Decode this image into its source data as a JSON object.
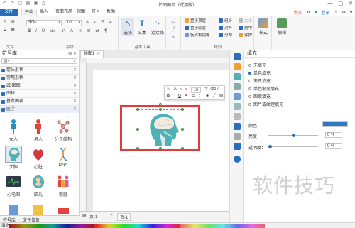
{
  "window": {
    "title": "亿图图示（试用版）",
    "controls": [
      "—",
      "▢",
      "✕"
    ]
  },
  "menu": {
    "items": [
      "文件",
      "开始",
      "插入",
      "页面布局",
      "视图",
      "符号",
      "帮助"
    ],
    "right": {
      "buy": "购买",
      "login": "登录"
    }
  },
  "ribbon": {
    "groups": {
      "file_label": "文件",
      "font_label": "字体",
      "basic_tools_label": "基本工具",
      "arrange_label": "排列"
    },
    "font": {
      "family": "宋体",
      "size": "10",
      "bold": "B",
      "italic": "I",
      "underline": "U",
      "strike": "abc",
      "grow": "A",
      "shrink": "A",
      "color": "A"
    },
    "tools": {
      "select": "选择",
      "text": "文本",
      "connector": "连接线"
    },
    "arrange": {
      "bring_front": "置于顶层",
      "send_back": "置于底层",
      "rotate": "旋转和镜像",
      "group": "组合",
      "align": "对齐",
      "distribute": "分布",
      "size": "大小",
      "center": "居中",
      "protect": "保护"
    },
    "style": {
      "label": "样式"
    },
    "edit": {
      "label": "编辑"
    }
  },
  "library": {
    "title": "符号库",
    "search_placeholder": "",
    "categories": [
      {
        "label": "箭头形状"
      },
      {
        "label": "常用形状"
      },
      {
        "label": "2D图图"
      },
      {
        "label": "图标"
      },
      {
        "label": "基本图表"
      },
      {
        "label": "医学"
      }
    ],
    "shapes": [
      {
        "label": "女人"
      },
      {
        "label": "男人"
      },
      {
        "label": "分子结构"
      },
      {
        "label": "大脑"
      },
      {
        "label": "心脏"
      },
      {
        "label": "DNA"
      },
      {
        "label": "心电图"
      },
      {
        "label": "脑儿"
      },
      {
        "label": "家庭"
      }
    ],
    "bottom_tabs": [
      "符号库",
      "文件恢复"
    ]
  },
  "canvas": {
    "doc_tab": "绘图1",
    "page_tab": "页-1",
    "page_tab2": "页-1",
    "float_toolbar": {
      "font_size": "10",
      "shrink": "A",
      "grow": "A",
      "align": "≡",
      "format": "B",
      "italic": "I",
      "underline": "U",
      "color": "A"
    }
  },
  "fill_panel": {
    "title": "填充",
    "options": [
      {
        "label": "无填充",
        "selected": false
      },
      {
        "label": "单色填充",
        "selected": true
      },
      {
        "label": "渐变填充",
        "selected": false
      },
      {
        "label": "单色渐变填充",
        "selected": false
      },
      {
        "label": "图案填充",
        "selected": false
      },
      {
        "label": "图片或纹理填充",
        "selected": false
      }
    ],
    "color_label": "颜色：",
    "brightness_label": "亮度：",
    "brightness_value": "0 %",
    "transparency_label": "透明度：",
    "transparency_value": "0 %",
    "color_value": "#2e78c2"
  },
  "status": {
    "label": "填充"
  },
  "watermark": "软件技巧",
  "colors": {
    "accent": "#2a6ebb",
    "head_teal": "#4fb1b5",
    "brain": "#f1eade",
    "highlight_box": "#e03c3c"
  }
}
